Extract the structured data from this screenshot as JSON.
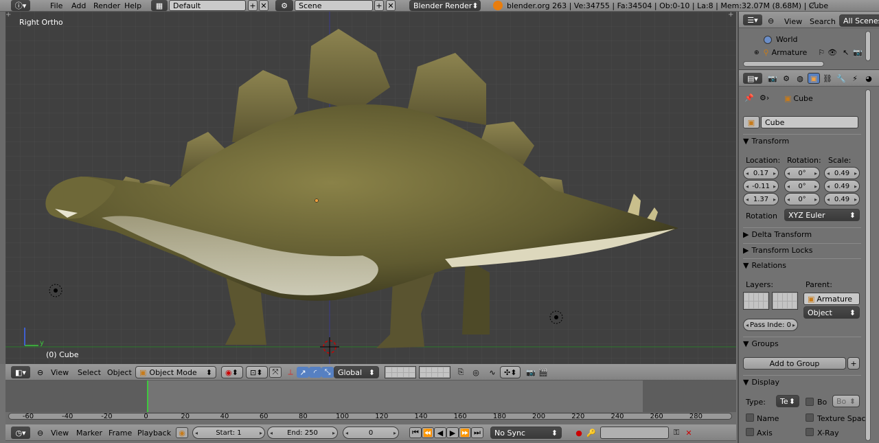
{
  "top": {
    "menus": [
      "File",
      "Add",
      "Render",
      "Help"
    ],
    "layout": "Default",
    "scene": "Scene",
    "engine": "Blender Render",
    "info": "blender.org 263 | Ve:34755 | Fa:34504 | Ob:0-10 | La:8 | Mem:32.07M (8.68M) | Cube"
  },
  "viewport": {
    "view_name": "Right Ortho",
    "object_label": "(0) Cube",
    "axis_y": "y"
  },
  "view3d_header": {
    "menus": [
      "View",
      "Select",
      "Object"
    ],
    "mode": "Object Mode",
    "orientation": "Global"
  },
  "timeline": {
    "ticks": [
      "-60",
      "-40",
      "-20",
      "0",
      "20",
      "40",
      "60",
      "80",
      "100",
      "120",
      "140",
      "160",
      "180",
      "200",
      "220",
      "240",
      "260",
      "280"
    ],
    "menus": [
      "View",
      "Marker",
      "Frame",
      "Playback"
    ],
    "start": "Start: 1",
    "end": "End: 250",
    "current": "0",
    "sync": "No Sync"
  },
  "outliner": {
    "menus": [
      "View",
      "Search"
    ],
    "filter": "All Scenes",
    "items": [
      "World",
      "Armature"
    ]
  },
  "properties": {
    "breadcrumb": "Cube",
    "object_name": "Cube",
    "transform_header": "Transform",
    "location_label": "Location:",
    "rotation_label": "Rotation:",
    "scale_label": "Scale:",
    "location": [
      "0.17",
      "-0.11",
      "1.37"
    ],
    "rotation": [
      "0°",
      "0°",
      "0°"
    ],
    "scale": [
      "0.49",
      "0.49",
      "0.49"
    ],
    "rotation_mode_label": "Rotation",
    "rotation_mode": "XYZ Euler",
    "delta_header": "Delta Transform",
    "locks_header": "Transform Locks",
    "relations_header": "Relations",
    "layers_label": "Layers:",
    "parent_label": "Parent:",
    "parent": "Armature",
    "parent_type": "Object",
    "pass_index": "Pass Inde: 0",
    "groups_header": "Groups",
    "add_group": "Add to Group",
    "display_header": "Display",
    "type_label": "Type:",
    "type_value": "Te",
    "bo_label": "Bo",
    "bo_value": "Bo",
    "name_label": "Name",
    "texture_label": "Texture Spac",
    "axis_label": "Axis",
    "xray_label": "X-Ray"
  },
  "colors": {
    "viewport_bg": "#404040",
    "panel_bg": "#727272",
    "header_bg": "#8c8c8c",
    "selected_tab": "#5680c2",
    "playhead": "#3ec83e"
  }
}
